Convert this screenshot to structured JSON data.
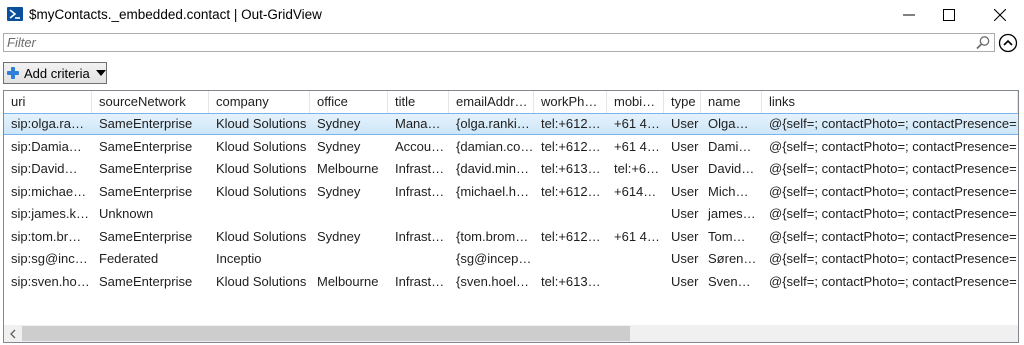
{
  "window": {
    "title": "$myContacts._embedded.contact | Out-GridView"
  },
  "filter": {
    "placeholder": "Filter"
  },
  "toolbar": {
    "add_criteria_label": "Add criteria"
  },
  "icons": {
    "app": "powershell-icon",
    "minimize": "minimize-icon",
    "maximize": "maximize-icon",
    "close": "close-icon",
    "filter_search": "search-icon",
    "collapse": "chevron-up-circle-icon",
    "add": "plus-icon",
    "dropdown": "dropdown-arrow-icon",
    "scroll_left": "chevron-left-icon"
  },
  "colors": {
    "accent": "#2f7ed8",
    "selection_bg": "#cce6f9",
    "selection_border": "#7ab4ea"
  },
  "grid": {
    "columns": [
      "uri",
      "sourceNetwork",
      "company",
      "office",
      "title",
      "emailAddr…",
      "workPh…",
      "mobi…",
      "type",
      "name",
      "links"
    ],
    "rows": [
      [
        "sip:olga.ra…",
        "SameEnterprise",
        "Kloud Solutions",
        "Sydney",
        "Mana…",
        "{olga.ranki…",
        "tel:+612…",
        "+61 4…",
        "User",
        "Olga…",
        "@{self=; contactPhoto=; contactPresence=;"
      ],
      [
        "sip:Damia…",
        "SameEnterprise",
        "Kloud Solutions",
        "Sydney",
        "Accou…",
        "{damian.co…",
        "tel:+612…",
        "+61 4…",
        "User",
        "Dami…",
        "@{self=; contactPhoto=; contactPresence=;"
      ],
      [
        "sip:David…",
        "SameEnterprise",
        "Kloud Solutions",
        "Melbourne",
        "Infrast…",
        "{david.min…",
        "tel:+613…",
        "tel:+6…",
        "User",
        "David…",
        "@{self=; contactPhoto=; contactPresence=;"
      ],
      [
        "sip:michae…",
        "SameEnterprise",
        "Kloud Solutions",
        "Sydney",
        "Infrast…",
        "{michael.h…",
        "tel:+612…",
        "+614…",
        "User",
        "Mich…",
        "@{self=; contactPhoto=; contactPresence=;"
      ],
      [
        "sip:james.k…",
        "Unknown",
        "",
        "",
        "",
        "",
        "",
        "",
        "User",
        "james…",
        "@{self=; contactPhoto=; contactPresence=;"
      ],
      [
        "sip:tom.br…",
        "SameEnterprise",
        "Kloud Solutions",
        "Sydney",
        "Infrast…",
        "{tom.brom…",
        "tel:+612…",
        "+61 4…",
        "User",
        "Tom…",
        "@{self=; contactPhoto=; contactPresence=;"
      ],
      [
        "sip:sg@inc…",
        "Federated",
        "Inceptio",
        "",
        "",
        "{sg@incep…",
        "",
        "",
        "User",
        "Søren…",
        "@{self=; contactPhoto=; contactPresence=;"
      ],
      [
        "sip:sven.ho…",
        "SameEnterprise",
        "Kloud Solutions",
        "Melbourne",
        "Infrast…",
        "{sven.hoel…",
        "tel:+613…",
        "",
        "User",
        "Sven…",
        "@{self=; contactPhoto=; contactPresence=;"
      ]
    ],
    "selected_row_index": 0
  },
  "scrollbar": {
    "horizontal_position_fraction": 0.0,
    "visible_fraction": 0.6
  }
}
